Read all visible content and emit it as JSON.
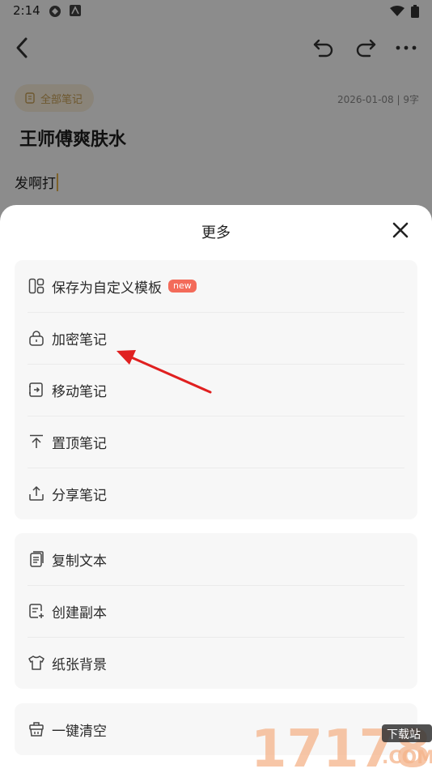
{
  "status": {
    "time": "2:14"
  },
  "note": {
    "folder_chip": "全部笔记",
    "meta": "2026-01-08 | 9字",
    "title": "王师傅爽肤水",
    "body": "发啊打"
  },
  "sheet": {
    "title": "更多",
    "groups": [
      {
        "items": [
          {
            "label": "保存为自定义模板",
            "icon": "template-icon",
            "badge": "new"
          },
          {
            "label": "加密笔记",
            "icon": "lock-icon"
          },
          {
            "label": "移动笔记",
            "icon": "move-icon"
          },
          {
            "label": "置顶笔记",
            "icon": "pin-top-icon"
          },
          {
            "label": "分享笔记",
            "icon": "share-icon"
          }
        ]
      },
      {
        "items": [
          {
            "label": "复制文本",
            "icon": "copy-text-icon"
          },
          {
            "label": "创建副本",
            "icon": "duplicate-icon"
          },
          {
            "label": "纸张背景",
            "icon": "paper-background-icon"
          }
        ]
      },
      {
        "items": [
          {
            "label": "一键清空",
            "icon": "clear-all-icon"
          }
        ]
      }
    ]
  },
  "watermark": {
    "text": "17178",
    "sub": "下载站",
    "domain": ".COM"
  },
  "colors": {
    "accent": "#f36b5a",
    "annotation_arrow": "#e02020",
    "chip": "#c9a156"
  }
}
